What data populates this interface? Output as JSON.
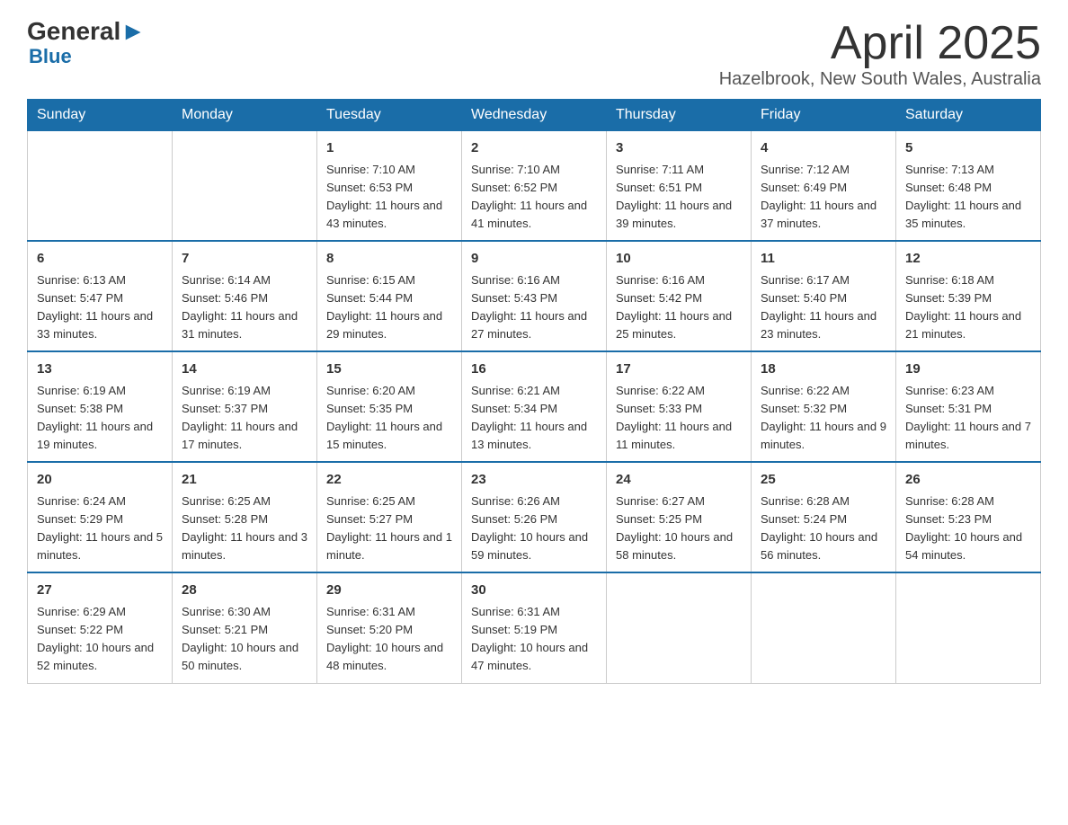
{
  "logo": {
    "general": "General",
    "blue": "Blue"
  },
  "title": {
    "month": "April 2025",
    "location": "Hazelbrook, New South Wales, Australia"
  },
  "weekdays": [
    "Sunday",
    "Monday",
    "Tuesday",
    "Wednesday",
    "Thursday",
    "Friday",
    "Saturday"
  ],
  "weeks": [
    [
      {
        "day": "",
        "sunrise": "",
        "sunset": "",
        "daylight": ""
      },
      {
        "day": "",
        "sunrise": "",
        "sunset": "",
        "daylight": ""
      },
      {
        "day": "1",
        "sunrise": "Sunrise: 7:10 AM",
        "sunset": "Sunset: 6:53 PM",
        "daylight": "Daylight: 11 hours and 43 minutes."
      },
      {
        "day": "2",
        "sunrise": "Sunrise: 7:10 AM",
        "sunset": "Sunset: 6:52 PM",
        "daylight": "Daylight: 11 hours and 41 minutes."
      },
      {
        "day": "3",
        "sunrise": "Sunrise: 7:11 AM",
        "sunset": "Sunset: 6:51 PM",
        "daylight": "Daylight: 11 hours and 39 minutes."
      },
      {
        "day": "4",
        "sunrise": "Sunrise: 7:12 AM",
        "sunset": "Sunset: 6:49 PM",
        "daylight": "Daylight: 11 hours and 37 minutes."
      },
      {
        "day": "5",
        "sunrise": "Sunrise: 7:13 AM",
        "sunset": "Sunset: 6:48 PM",
        "daylight": "Daylight: 11 hours and 35 minutes."
      }
    ],
    [
      {
        "day": "6",
        "sunrise": "Sunrise: 6:13 AM",
        "sunset": "Sunset: 5:47 PM",
        "daylight": "Daylight: 11 hours and 33 minutes."
      },
      {
        "day": "7",
        "sunrise": "Sunrise: 6:14 AM",
        "sunset": "Sunset: 5:46 PM",
        "daylight": "Daylight: 11 hours and 31 minutes."
      },
      {
        "day": "8",
        "sunrise": "Sunrise: 6:15 AM",
        "sunset": "Sunset: 5:44 PM",
        "daylight": "Daylight: 11 hours and 29 minutes."
      },
      {
        "day": "9",
        "sunrise": "Sunrise: 6:16 AM",
        "sunset": "Sunset: 5:43 PM",
        "daylight": "Daylight: 11 hours and 27 minutes."
      },
      {
        "day": "10",
        "sunrise": "Sunrise: 6:16 AM",
        "sunset": "Sunset: 5:42 PM",
        "daylight": "Daylight: 11 hours and 25 minutes."
      },
      {
        "day": "11",
        "sunrise": "Sunrise: 6:17 AM",
        "sunset": "Sunset: 5:40 PM",
        "daylight": "Daylight: 11 hours and 23 minutes."
      },
      {
        "day": "12",
        "sunrise": "Sunrise: 6:18 AM",
        "sunset": "Sunset: 5:39 PM",
        "daylight": "Daylight: 11 hours and 21 minutes."
      }
    ],
    [
      {
        "day": "13",
        "sunrise": "Sunrise: 6:19 AM",
        "sunset": "Sunset: 5:38 PM",
        "daylight": "Daylight: 11 hours and 19 minutes."
      },
      {
        "day": "14",
        "sunrise": "Sunrise: 6:19 AM",
        "sunset": "Sunset: 5:37 PM",
        "daylight": "Daylight: 11 hours and 17 minutes."
      },
      {
        "day": "15",
        "sunrise": "Sunrise: 6:20 AM",
        "sunset": "Sunset: 5:35 PM",
        "daylight": "Daylight: 11 hours and 15 minutes."
      },
      {
        "day": "16",
        "sunrise": "Sunrise: 6:21 AM",
        "sunset": "Sunset: 5:34 PM",
        "daylight": "Daylight: 11 hours and 13 minutes."
      },
      {
        "day": "17",
        "sunrise": "Sunrise: 6:22 AM",
        "sunset": "Sunset: 5:33 PM",
        "daylight": "Daylight: 11 hours and 11 minutes."
      },
      {
        "day": "18",
        "sunrise": "Sunrise: 6:22 AM",
        "sunset": "Sunset: 5:32 PM",
        "daylight": "Daylight: 11 hours and 9 minutes."
      },
      {
        "day": "19",
        "sunrise": "Sunrise: 6:23 AM",
        "sunset": "Sunset: 5:31 PM",
        "daylight": "Daylight: 11 hours and 7 minutes."
      }
    ],
    [
      {
        "day": "20",
        "sunrise": "Sunrise: 6:24 AM",
        "sunset": "Sunset: 5:29 PM",
        "daylight": "Daylight: 11 hours and 5 minutes."
      },
      {
        "day": "21",
        "sunrise": "Sunrise: 6:25 AM",
        "sunset": "Sunset: 5:28 PM",
        "daylight": "Daylight: 11 hours and 3 minutes."
      },
      {
        "day": "22",
        "sunrise": "Sunrise: 6:25 AM",
        "sunset": "Sunset: 5:27 PM",
        "daylight": "Daylight: 11 hours and 1 minute."
      },
      {
        "day": "23",
        "sunrise": "Sunrise: 6:26 AM",
        "sunset": "Sunset: 5:26 PM",
        "daylight": "Daylight: 10 hours and 59 minutes."
      },
      {
        "day": "24",
        "sunrise": "Sunrise: 6:27 AM",
        "sunset": "Sunset: 5:25 PM",
        "daylight": "Daylight: 10 hours and 58 minutes."
      },
      {
        "day": "25",
        "sunrise": "Sunrise: 6:28 AM",
        "sunset": "Sunset: 5:24 PM",
        "daylight": "Daylight: 10 hours and 56 minutes."
      },
      {
        "day": "26",
        "sunrise": "Sunrise: 6:28 AM",
        "sunset": "Sunset: 5:23 PM",
        "daylight": "Daylight: 10 hours and 54 minutes."
      }
    ],
    [
      {
        "day": "27",
        "sunrise": "Sunrise: 6:29 AM",
        "sunset": "Sunset: 5:22 PM",
        "daylight": "Daylight: 10 hours and 52 minutes."
      },
      {
        "day": "28",
        "sunrise": "Sunrise: 6:30 AM",
        "sunset": "Sunset: 5:21 PM",
        "daylight": "Daylight: 10 hours and 50 minutes."
      },
      {
        "day": "29",
        "sunrise": "Sunrise: 6:31 AM",
        "sunset": "Sunset: 5:20 PM",
        "daylight": "Daylight: 10 hours and 48 minutes."
      },
      {
        "day": "30",
        "sunrise": "Sunrise: 6:31 AM",
        "sunset": "Sunset: 5:19 PM",
        "daylight": "Daylight: 10 hours and 47 minutes."
      },
      {
        "day": "",
        "sunrise": "",
        "sunset": "",
        "daylight": ""
      },
      {
        "day": "",
        "sunrise": "",
        "sunset": "",
        "daylight": ""
      },
      {
        "day": "",
        "sunrise": "",
        "sunset": "",
        "daylight": ""
      }
    ]
  ]
}
